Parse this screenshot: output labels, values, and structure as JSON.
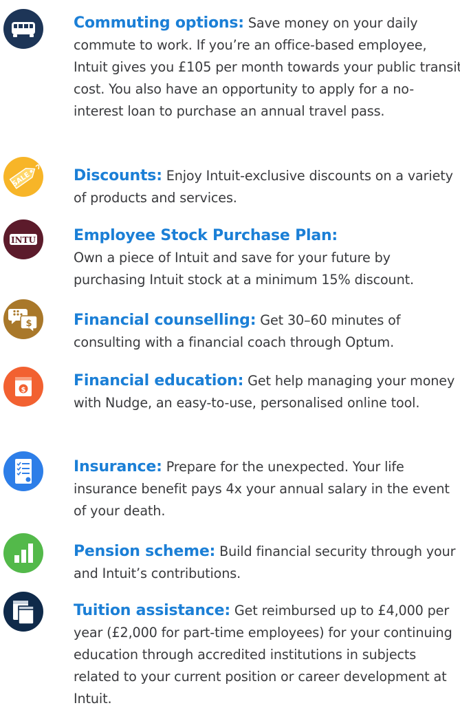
{
  "benefits": [
    {
      "icon": "bus-icon",
      "title": "Commuting options:",
      "body": "Save money on your daily commute to work. If you’re an office-based employee, Intuit gives you £105 per month towards your public transit cost. You also have an opportunity to apply for a no-interest loan to purchase an annual travel pass."
    },
    {
      "icon": "sale-tag-icon",
      "icon_label": "SALE",
      "title": "Discounts:",
      "body": "Enjoy Intuit-exclusive discounts on a variety of products and services."
    },
    {
      "icon": "stock-ticker-icon",
      "icon_label": "INTU",
      "title": "Employee Stock Purchase Plan:",
      "body": "Own a piece of Intuit and save for your future by purchasing Intuit stock at a minimum 15% discount."
    },
    {
      "icon": "chat-bubbles-dollar-icon",
      "title": "Financial counselling:",
      "body": "Get 30–60 minutes of consulting with a financial coach through Optum."
    },
    {
      "icon": "money-book-icon",
      "title": "Financial education:",
      "body": "Get help managing your money with Nudge, an easy-to-use, personalised online tool."
    },
    {
      "icon": "checklist-document-icon",
      "title": "Insurance:",
      "body": "Prepare for the unexpected. Your life insurance benefit pays 4x your annual salary in the event of your death."
    },
    {
      "icon": "bar-chart-icon",
      "title": "Pension scheme:",
      "body": "Build financial security through your and Intuit’s contributions."
    },
    {
      "icon": "books-icon",
      "title": "Tuition assistance:",
      "body": "Get reimbursed up to £4,000 per year (£2,000 for part-time employees) for your continuing education through accredited institutions in subjects related to your current position or career development at Intuit."
    }
  ],
  "colors": {
    "title": "#1b7fd6",
    "body_text": "#393a3d",
    "bus_bg": "#1d3557",
    "sale_bg": "#f7b528",
    "intu_bg": "#5c1b2b",
    "chat_bg": "#a9782a",
    "book_bg": "#f26131",
    "insurance_bg": "#2d7ee8",
    "pension_bg": "#53b94a",
    "tuition_bg": "#0f2a4a"
  }
}
